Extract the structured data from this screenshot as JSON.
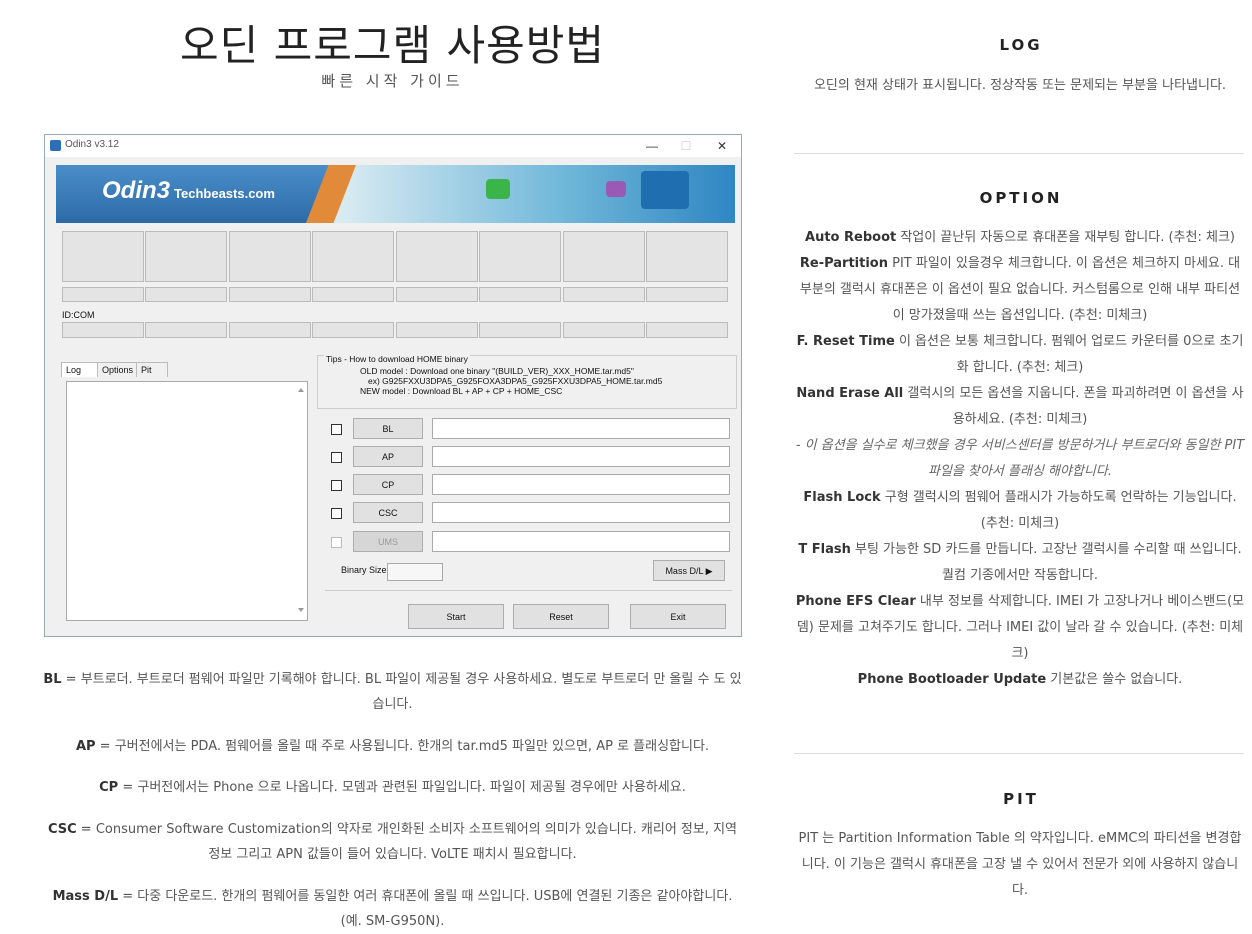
{
  "page": {
    "title": "오딘 프로그램 사용방법",
    "subtitle": "빠른 시작 가이드"
  },
  "odin": {
    "window_title": "Odin3 v3.12",
    "minimize": "—",
    "maximize": "☐",
    "close": "✕",
    "logo": "Odin3",
    "logo_site": "Techbeasts.com",
    "id_com_label": "ID:COM",
    "tabs": [
      "Log",
      "Options",
      "Pit"
    ],
    "tips": {
      "title": "Tips - How to download HOME binary",
      "line1": "OLD model  : Download one binary    \"(BUILD_VER)_XXX_HOME.tar.md5\"",
      "line2": "ex) G925FXXU3DPA5_G925FOXA3DPA5_G925FXXU3DPA5_HOME.tar.md5",
      "line3": "NEW model : Download BL + AP + CP + HOME_CSC"
    },
    "file_buttons": [
      "BL",
      "AP",
      "CP",
      "CSC",
      "UMS"
    ],
    "binary_size_label": "Binary Size",
    "mass_dl": "Mass D/L ▶",
    "start": "Start",
    "reset": "Reset",
    "exit": "Exit"
  },
  "descriptions": {
    "bl": {
      "term": "BL",
      "text": " = 부트로더. 부트로더 펌웨어 파일만 기록해야 합니다. BL 파일이 제공될 경우 사용하세요. 별도로 부트로더 만 올릴 수 도 있습니다."
    },
    "ap": {
      "term": "AP",
      "text": " = 구버전에서는 PDA. 펌웨어를 올릴 때 주로 사용됩니다. 한개의 tar.md5 파일만 있으면, AP 로 플래싱합니다."
    },
    "cp": {
      "term": "CP",
      "text": " = 구버전에서는 Phone 으로 나옵니다. 모뎀과 관련된 파일입니다. 파일이 제공될 경우에만 사용하세요."
    },
    "csc": {
      "term": "CSC",
      "text": " = Consumer Software Customization의 약자로 개인화된 소비자 소프트웨어의 의미가 있습니다. 캐리어 정보, 지역 정보 그리고 APN 값들이 들어 있습니다. VoLTE 패치시 필요합니다."
    },
    "mass": {
      "term": "Mass D/L",
      "text": " = 다중 다운로드. 한개의 펌웨어를 동일한 여러 휴대폰에 올릴 때 쓰입니다. USB에 연결된 기종은 같아야합니다. (예. SM-G950N)."
    }
  },
  "right": {
    "log": {
      "heading": "LOG",
      "text": "오딘의 현재 상태가 표시됩니다. 정상작동 또는 문제되는 부분을 나타냅니다."
    },
    "option": {
      "heading": "OPTION",
      "auto_reboot": {
        "term": "Auto Reboot",
        "text": " 작업이 끝난뒤 자동으로 휴대폰을 재부팅 합니다. (추천: 체크)"
      },
      "repartition": {
        "term": "Re-Partition",
        "text": " PIT 파일이 있을경우 체크합니다. 이 옵션은 체크하지 마세요. 대부분의 갤럭시 휴대폰은 이 옵션이 필요 없습니다. 커스텀롬으로 인해 내부 파티션이 망가졌을때 쓰는 옵션입니다. (추천: 미체크)"
      },
      "freset": {
        "term": "F. Reset Time",
        "text": " 이 옵션은 보통 체크합니다. 펌웨어 업로드 카운터를 0으로 초기화 합니다. (추천: 체크)"
      },
      "nand": {
        "term": "Nand Erase All",
        "text": " 갤럭시의 모든 옵션을 지웁니다. 폰을 파괴하려면 이 옵션을 사용하세요. (추천: 미체크)"
      },
      "nand_note": "- 이 옵션을 실수로 체크했을 경우 서비스센터를 방문하거나 부트로더와 동일한 PIT 파일을 찾아서 플래싱 해야합니다.",
      "flash_lock": {
        "term": "Flash Lock",
        "text": " 구형 갤럭시의 펌웨어 플래시가 가능하도록 언락하는 기능입니다. (추천: 미체크)"
      },
      "tflash": {
        "term": "T Flash",
        "text": " 부팅 가능한 SD 카드를 만듭니다. 고장난 갤럭시를 수리할 때 쓰입니다. 퀄컴 기종에서만 작동합니다."
      },
      "efs": {
        "term": "Phone EFS Clear",
        "text": " 내부 정보를 삭제합니다. IMEI 가 고장나거나 베이스밴드(모뎀) 문제를 고쳐주기도 합니다. 그러나 IMEI 값이 날라 갈 수 있습니다. (추천: 미체크)"
      },
      "bootloader": {
        "term": "Phone Bootloader Update",
        "text": " 기본값은 쓸수 없습니다."
      }
    },
    "pit": {
      "heading": "PIT",
      "text": "PIT 는 Partition Information Table 의 약자입니다. eMMC의 파티션을 변경합니다. 이 기능은 갤럭시 휴대폰을 고장 낼 수 있어서 전문가 외에 사용하지 않습니다."
    }
  }
}
